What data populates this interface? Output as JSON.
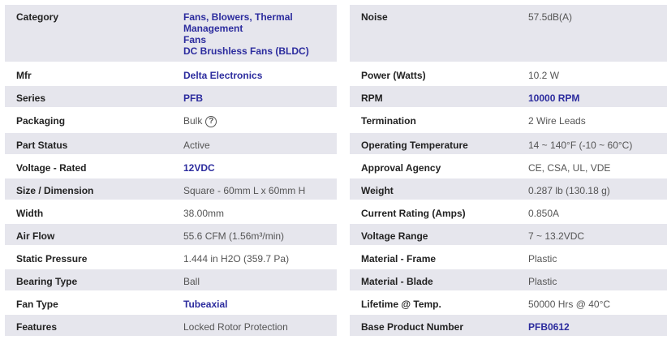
{
  "left_rows": [
    {
      "label": "Category",
      "values": [
        "Fans, Blowers, Thermal Management",
        "Fans",
        "DC Brushless Fans (BLDC)"
      ],
      "link": true,
      "h": 72
    },
    {
      "label": "Mfr",
      "values": [
        "Delta Electronics"
      ],
      "link": true,
      "h": 28
    },
    {
      "label": "Series",
      "values": [
        "PFB"
      ],
      "link": true,
      "h": 28
    },
    {
      "label": "Packaging",
      "values": [
        "Bulk"
      ],
      "link": false,
      "help": true,
      "h": 30
    },
    {
      "label": "Part Status",
      "values": [
        "Active"
      ],
      "link": false,
      "h": 28
    },
    {
      "label": "Voltage - Rated",
      "values": [
        "12VDC"
      ],
      "link": true,
      "h": 28
    },
    {
      "label": "Size / Dimension",
      "values": [
        "Square - 60mm L x 60mm H"
      ],
      "link": false,
      "h": 28
    },
    {
      "label": "Width",
      "values": [
        "38.00mm"
      ],
      "link": false,
      "h": 28
    },
    {
      "label": "Air Flow",
      "values": [
        "55.6 CFM (1.56m³/min)"
      ],
      "link": false,
      "h": 28
    },
    {
      "label": "Static Pressure",
      "values": [
        "1.444 in H2O (359.7 Pa)"
      ],
      "link": false,
      "h": 28
    },
    {
      "label": "Bearing Type",
      "values": [
        "Ball"
      ],
      "link": false,
      "h": 28
    },
    {
      "label": "Fan Type",
      "values": [
        "Tubeaxial"
      ],
      "link": true,
      "h": 28
    },
    {
      "label": "Features",
      "values": [
        "Locked Rotor Protection"
      ],
      "link": false,
      "h": 28
    }
  ],
  "right_rows": [
    {
      "label": "Noise",
      "values": [
        "57.5dB(A)"
      ],
      "link": false,
      "h": 72
    },
    {
      "label": "Power (Watts)",
      "values": [
        "10.2 W"
      ],
      "link": false,
      "h": 28
    },
    {
      "label": "RPM",
      "values": [
        "10000 RPM"
      ],
      "link": true,
      "h": 28
    },
    {
      "label": "Termination",
      "values": [
        "2 Wire Leads"
      ],
      "link": false,
      "h": 30
    },
    {
      "label": "Operating Temperature",
      "values": [
        "14 ~ 140°F (-10 ~ 60°C)"
      ],
      "link": false,
      "h": 28
    },
    {
      "label": "Approval Agency",
      "values": [
        "CE, CSA, UL, VDE"
      ],
      "link": false,
      "h": 28
    },
    {
      "label": "Weight",
      "values": [
        "0.287 lb (130.18 g)"
      ],
      "link": false,
      "h": 28
    },
    {
      "label": "Current Rating (Amps)",
      "values": [
        "0.850A"
      ],
      "link": false,
      "h": 28
    },
    {
      "label": "Voltage Range",
      "values": [
        "7 ~ 13.2VDC"
      ],
      "link": false,
      "h": 28
    },
    {
      "label": "Material - Frame",
      "values": [
        "Plastic"
      ],
      "link": false,
      "h": 28
    },
    {
      "label": "Material - Blade",
      "values": [
        "Plastic"
      ],
      "link": false,
      "h": 28
    },
    {
      "label": "Lifetime @ Temp.",
      "values": [
        "50000 Hrs @ 40°C"
      ],
      "link": false,
      "h": 28
    },
    {
      "label": "Base Product Number",
      "values": [
        "PFB0612"
      ],
      "link": true,
      "h": 28
    }
  ],
  "icons": {
    "help": "question-circle-icon"
  },
  "colors": {
    "link": "#2c2c9e",
    "row_shade": "#e6e6ed",
    "label": "#222222",
    "value": "#555555"
  }
}
